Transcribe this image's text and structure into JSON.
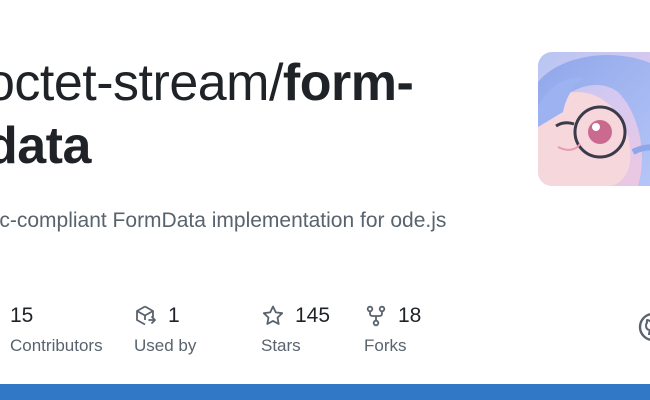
{
  "repo": {
    "owner_prefix": "octet-stream/",
    "name": "form-data",
    "description": "pec-compliant FormData implementation for ode.js"
  },
  "stats": {
    "contributors": {
      "value": "15",
      "label": "Contributors",
      "icon": "people-icon"
    },
    "used_by": {
      "value": "1",
      "label": "Used by",
      "icon": "package-dependents-icon"
    },
    "stars": {
      "value": "145",
      "label": "Stars",
      "icon": "star-icon"
    },
    "forks": {
      "value": "18",
      "label": "Forks",
      "icon": "repo-forked-icon"
    }
  },
  "colors": {
    "language_bar": "#3178c6",
    "text_primary": "#1f2328",
    "text_secondary": "#59636e"
  }
}
